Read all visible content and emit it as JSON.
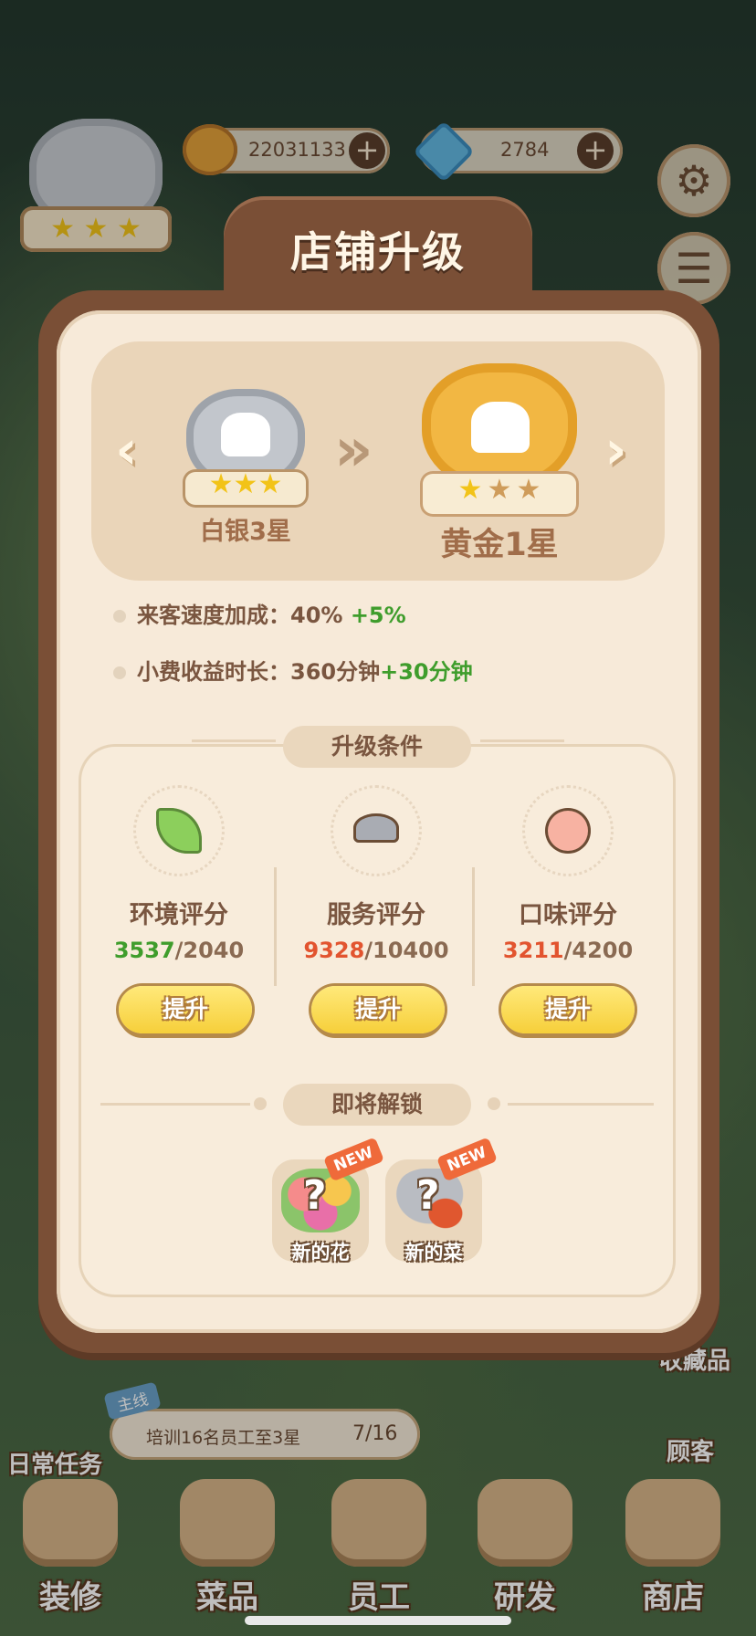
{
  "hud": {
    "coins": "22031133",
    "gems": "2784",
    "plus": "+"
  },
  "side_menu": {
    "daily_tasks": "日常任务",
    "collection": "收藏品",
    "customers": "顾客"
  },
  "quest": {
    "tag": "主线",
    "text": "培训16名员工至3星",
    "progress": "7/16"
  },
  "bottom_nav": [
    {
      "label": "装修"
    },
    {
      "label": "菜品"
    },
    {
      "label": "员工"
    },
    {
      "label": "研发"
    },
    {
      "label": "商店"
    }
  ],
  "dialog": {
    "title": "店铺升级",
    "current_rank": "白银3星",
    "next_rank": "黄金1星",
    "current_stars": 3,
    "next_stars_filled": 1,
    "stats": [
      {
        "label": "来客速度加成：",
        "value": "40%",
        "bonus": "+5%"
      },
      {
        "label": "小费收益时长：",
        "value": "360分钟",
        "bonus": "+30分钟"
      }
    ],
    "conditions_title": "升级条件",
    "conditions": [
      {
        "name": "环境评分",
        "current": "3537",
        "sep": "/",
        "target": "2040",
        "met": true,
        "button": "提升"
      },
      {
        "name": "服务评分",
        "current": "9328",
        "sep": "/",
        "target": "10400",
        "met": false,
        "button": "提升"
      },
      {
        "name": "口味评分",
        "current": "3211",
        "sep": "/",
        "target": "4200",
        "met": false,
        "button": "提升"
      }
    ],
    "unlock_title": "即将解锁",
    "unlocks": [
      {
        "label": "新的花",
        "tag": "NEW",
        "mark": "?"
      },
      {
        "label": "新的菜",
        "tag": "NEW",
        "mark": "?"
      }
    ]
  },
  "colors": {
    "met": "#3f9d2c",
    "unmet": "#e2542f",
    "button": "#f6cf3a",
    "frame": "#7a4f36"
  }
}
